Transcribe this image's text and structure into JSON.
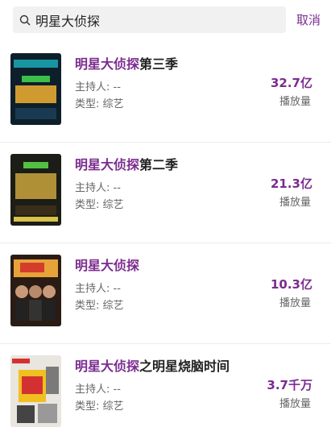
{
  "search": {
    "query": "明星大侦探",
    "cancel_label": "取消"
  },
  "results": [
    {
      "title_highlight": "明星大侦探",
      "title_rest": "第三季",
      "host": "主持人: --",
      "genre": "类型: 综艺",
      "play_count": "32.7亿",
      "play_label": "播放量",
      "poster_colors": [
        "#0d1f2a",
        "#1ec8d6",
        "#f2b233"
      ]
    },
    {
      "title_highlight": "明星大侦探",
      "title_rest": "第二季",
      "host": "主持人: --",
      "genre": "类型: 综艺",
      "play_count": "21.3亿",
      "play_label": "播放量",
      "poster_colors": [
        "#1b1d16",
        "#c9a43c",
        "#54c043"
      ]
    },
    {
      "title_highlight": "明星大侦探",
      "title_rest": "",
      "host": "主持人: --",
      "genre": "类型: 综艺",
      "play_count": "10.3亿",
      "play_label": "播放量",
      "poster_colors": [
        "#2a1c14",
        "#e8a23a",
        "#d43d2c"
      ]
    },
    {
      "title_highlight": "明星大侦探",
      "title_rest": "之明星烧脑时间",
      "host": "主持人: --",
      "genre": "类型: 综艺",
      "play_count": "3.7千万",
      "play_label": "播放量",
      "poster_colors": [
        "#e9e5df",
        "#d33131",
        "#f0c020"
      ]
    }
  ]
}
